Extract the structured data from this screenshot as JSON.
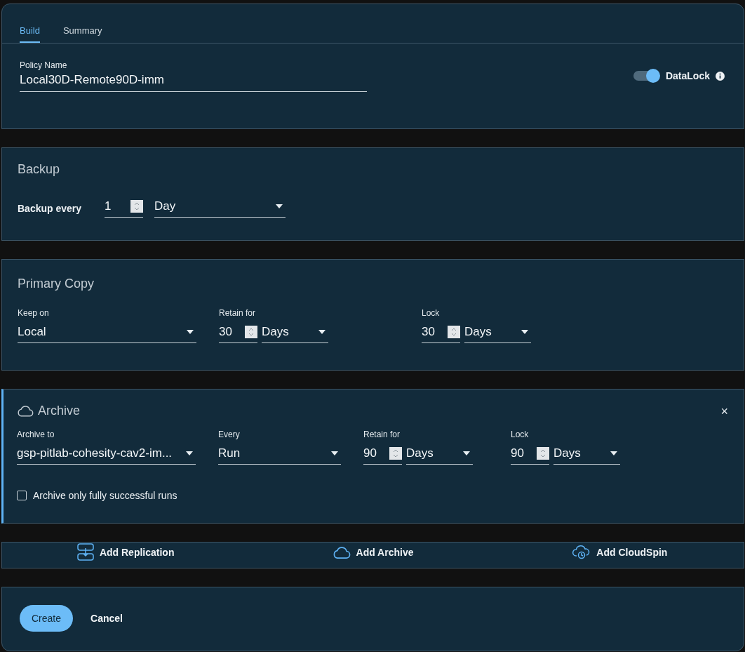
{
  "tabs": [
    {
      "label": "Build",
      "selected": true
    },
    {
      "label": "Summary",
      "selected": false
    }
  ],
  "policy_name": {
    "label": "Policy Name",
    "value": "Local30D-Remote90D-imm"
  },
  "datalock": {
    "label": "DataLock",
    "on": true
  },
  "backup": {
    "title": "Backup",
    "label": "Backup every",
    "number": "1",
    "unit": "Day"
  },
  "primary_copy": {
    "title": "Primary Copy",
    "fields": [
      {
        "kind": "select",
        "label": "Keep on",
        "value": "Local"
      },
      {
        "kind": "number_unit",
        "label": "Retain for",
        "number": "30",
        "unit": "Days"
      },
      {
        "kind": "number_unit",
        "label": "Lock",
        "number": "30",
        "unit": "Days"
      }
    ]
  },
  "archive": {
    "title": "Archive",
    "close": "×",
    "fields": [
      {
        "kind": "select",
        "label": "Archive to",
        "value": "gsp-pitlab-cohesity-cav2-im..."
      },
      {
        "kind": "select",
        "label": "Every",
        "value": "Run"
      },
      {
        "kind": "number_unit",
        "label": "Retain for",
        "number": "90",
        "unit": "Days"
      },
      {
        "kind": "number_unit",
        "label": "Lock",
        "number": "90",
        "unit": "Days"
      }
    ],
    "checkbox": {
      "label": "Archive only fully successful runs",
      "checked": false
    }
  },
  "add_actions": [
    {
      "kind": "replication",
      "label": "Add Replication"
    },
    {
      "kind": "archive",
      "label": "Add Archive"
    },
    {
      "kind": "cloudspin",
      "label": "Add CloudSpin"
    }
  ],
  "buttons": [
    {
      "kind": "primary",
      "label": "Create"
    },
    {
      "kind": "text",
      "label": "Cancel"
    }
  ]
}
